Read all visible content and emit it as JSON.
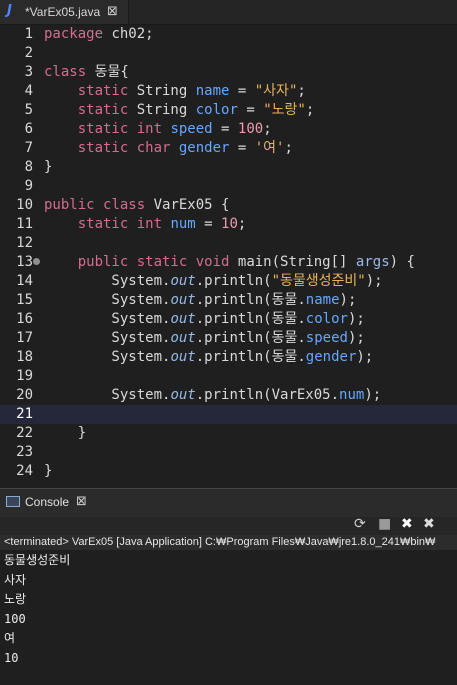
{
  "editor": {
    "tab_title": "*VarEx05.java",
    "tab_close": "⊠",
    "java_icon": "J",
    "lines": [
      {
        "n": "1",
        "parts": [
          {
            "t": "package ",
            "c": "kw"
          },
          {
            "t": "ch02;",
            "c": "normal"
          }
        ]
      },
      {
        "n": "2",
        "parts": []
      },
      {
        "n": "3",
        "parts": [
          {
            "t": "class ",
            "c": "kw"
          },
          {
            "t": "동물{",
            "c": "normal"
          }
        ]
      },
      {
        "n": "4",
        "parts": [
          {
            "t": "    static ",
            "c": "kw"
          },
          {
            "t": "String ",
            "c": "normal"
          },
          {
            "t": "name",
            "c": "field"
          },
          {
            "t": " = ",
            "c": "normal"
          },
          {
            "t": "\"사자\"",
            "c": "str"
          },
          {
            "t": ";",
            "c": "normal"
          }
        ]
      },
      {
        "n": "5",
        "parts": [
          {
            "t": "    static ",
            "c": "kw"
          },
          {
            "t": "String ",
            "c": "normal"
          },
          {
            "t": "color",
            "c": "field"
          },
          {
            "t": " = ",
            "c": "normal"
          },
          {
            "t": "\"노랑\"",
            "c": "str"
          },
          {
            "t": ";",
            "c": "normal"
          }
        ]
      },
      {
        "n": "6",
        "parts": [
          {
            "t": "    static ",
            "c": "kw"
          },
          {
            "t": "int ",
            "c": "kw"
          },
          {
            "t": "speed",
            "c": "field"
          },
          {
            "t": " = ",
            "c": "normal"
          },
          {
            "t": "100",
            "c": "num"
          },
          {
            "t": ";",
            "c": "normal"
          }
        ]
      },
      {
        "n": "7",
        "parts": [
          {
            "t": "    static ",
            "c": "kw"
          },
          {
            "t": "char ",
            "c": "kw"
          },
          {
            "t": "gender",
            "c": "field"
          },
          {
            "t": " = ",
            "c": "normal"
          },
          {
            "t": "'여'",
            "c": "str"
          },
          {
            "t": ";",
            "c": "normal"
          }
        ]
      },
      {
        "n": "8",
        "parts": [
          {
            "t": "}",
            "c": "normal"
          }
        ]
      },
      {
        "n": "9",
        "parts": []
      },
      {
        "n": "10",
        "parts": [
          {
            "t": "public ",
            "c": "kw"
          },
          {
            "t": "class ",
            "c": "kw"
          },
          {
            "t": "VarEx05 {",
            "c": "normal"
          }
        ]
      },
      {
        "n": "11",
        "parts": [
          {
            "t": "    static ",
            "c": "kw"
          },
          {
            "t": "int ",
            "c": "kw"
          },
          {
            "t": "num",
            "c": "field"
          },
          {
            "t": " = ",
            "c": "normal"
          },
          {
            "t": "10",
            "c": "num"
          },
          {
            "t": ";",
            "c": "normal"
          }
        ]
      },
      {
        "n": "12",
        "parts": []
      },
      {
        "n": "13",
        "fold": true,
        "parts": [
          {
            "t": "    public ",
            "c": "kw"
          },
          {
            "t": "static ",
            "c": "kw"
          },
          {
            "t": "void ",
            "c": "kw"
          },
          {
            "t": "main(String[] ",
            "c": "normal"
          },
          {
            "t": "args",
            "c": "param"
          },
          {
            "t": ") {",
            "c": "normal"
          }
        ]
      },
      {
        "n": "14",
        "parts": [
          {
            "t": "        System.",
            "c": "normal"
          },
          {
            "t": "out",
            "c": "sysout"
          },
          {
            "t": ".println(",
            "c": "normal"
          },
          {
            "t": "\"동물생성준비\"",
            "c": "str"
          },
          {
            "t": ");",
            "c": "normal"
          }
        ]
      },
      {
        "n": "15",
        "parts": [
          {
            "t": "        System.",
            "c": "normal"
          },
          {
            "t": "out",
            "c": "sysout"
          },
          {
            "t": ".println(동물.",
            "c": "normal"
          },
          {
            "t": "name",
            "c": "field"
          },
          {
            "t": ");",
            "c": "normal"
          }
        ]
      },
      {
        "n": "16",
        "parts": [
          {
            "t": "        System.",
            "c": "normal"
          },
          {
            "t": "out",
            "c": "sysout"
          },
          {
            "t": ".println(동물.",
            "c": "normal"
          },
          {
            "t": "color",
            "c": "field"
          },
          {
            "t": ");",
            "c": "normal"
          }
        ]
      },
      {
        "n": "17",
        "parts": [
          {
            "t": "        System.",
            "c": "normal"
          },
          {
            "t": "out",
            "c": "sysout"
          },
          {
            "t": ".println(동물.",
            "c": "normal"
          },
          {
            "t": "speed",
            "c": "field"
          },
          {
            "t": ");",
            "c": "normal"
          }
        ]
      },
      {
        "n": "18",
        "parts": [
          {
            "t": "        System.",
            "c": "normal"
          },
          {
            "t": "out",
            "c": "sysout"
          },
          {
            "t": ".println(동물.",
            "c": "normal"
          },
          {
            "t": "gender",
            "c": "field"
          },
          {
            "t": ");",
            "c": "normal"
          }
        ]
      },
      {
        "n": "19",
        "parts": []
      },
      {
        "n": "20",
        "parts": [
          {
            "t": "        System.",
            "c": "normal"
          },
          {
            "t": "out",
            "c": "sysout"
          },
          {
            "t": ".println(VarEx05.",
            "c": "normal"
          },
          {
            "t": "num",
            "c": "field"
          },
          {
            "t": ");",
            "c": "normal"
          }
        ]
      },
      {
        "n": "21",
        "current": true,
        "parts": []
      },
      {
        "n": "22",
        "parts": [
          {
            "t": "    }",
            "c": "normal"
          }
        ]
      },
      {
        "n": "23",
        "parts": []
      },
      {
        "n": "24",
        "parts": [
          {
            "t": "}",
            "c": "normal"
          }
        ]
      }
    ]
  },
  "console": {
    "title": "Console",
    "close": "⊠",
    "status": "<terminated> VarEx05 [Java Application] C:₩Program Files₩Java₩jre1.8.0_241₩bin₩",
    "output": [
      "동물생성준비",
      "사자",
      "노랑",
      "100",
      "여",
      "10"
    ],
    "tools": [
      "⟳",
      "■",
      "✖",
      "✖"
    ]
  }
}
